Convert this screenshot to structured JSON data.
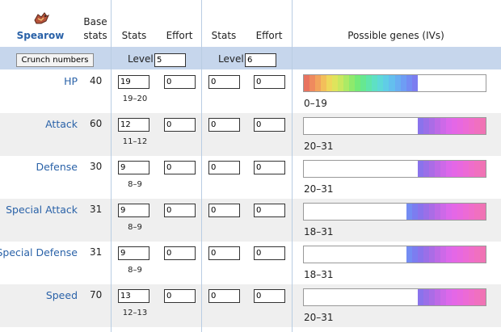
{
  "pokemon": {
    "name": "Spearow",
    "icon": "spearow-sprite"
  },
  "headers": {
    "base_stats": "Base stats",
    "stats": "Stats",
    "effort": "Effort",
    "stats2": "Stats",
    "effort2": "Effort",
    "genes": "Possible genes (IVs)"
  },
  "controls": {
    "crunch": "Crunch numbers",
    "level_label": "Level",
    "level1": "5",
    "level_label2": "Level",
    "level2": "6"
  },
  "rows": [
    {
      "name": "HP",
      "base": "40",
      "stats1": "19",
      "effort1": "0",
      "stats2": "0",
      "effort2": "0",
      "stat_range": "19–20",
      "iv_range": "0–19",
      "iv_min": 0,
      "iv_max": 19
    },
    {
      "name": "Attack",
      "base": "60",
      "stats1": "12",
      "effort1": "0",
      "stats2": "0",
      "effort2": "0",
      "stat_range": "11–12",
      "iv_range": "20–31",
      "iv_min": 20,
      "iv_max": 31
    },
    {
      "name": "Defense",
      "base": "30",
      "stats1": "9",
      "effort1": "0",
      "stats2": "0",
      "effort2": "0",
      "stat_range": "8–9",
      "iv_range": "20–31",
      "iv_min": 20,
      "iv_max": 31
    },
    {
      "name": "Special Attack",
      "base": "31",
      "stats1": "9",
      "effort1": "0",
      "stats2": "0",
      "effort2": "0",
      "stat_range": "8–9",
      "iv_range": "18–31",
      "iv_min": 18,
      "iv_max": 31
    },
    {
      "name": "Special Defense",
      "base": "31",
      "stats1": "9",
      "effort1": "0",
      "stats2": "0",
      "effort2": "0",
      "stat_range": "8–9",
      "iv_range": "18–31",
      "iv_min": 18,
      "iv_max": 31
    },
    {
      "name": "Speed",
      "base": "70",
      "stats1": "13",
      "effort1": "0",
      "stats2": "0",
      "effort2": "0",
      "stat_range": "12–13",
      "iv_range": "20–31",
      "iv_min": 20,
      "iv_max": 31
    }
  ],
  "colors": {
    "accent": "#2a62a8",
    "header_band": "#c6d6ec",
    "alt_row": "#efefef"
  }
}
